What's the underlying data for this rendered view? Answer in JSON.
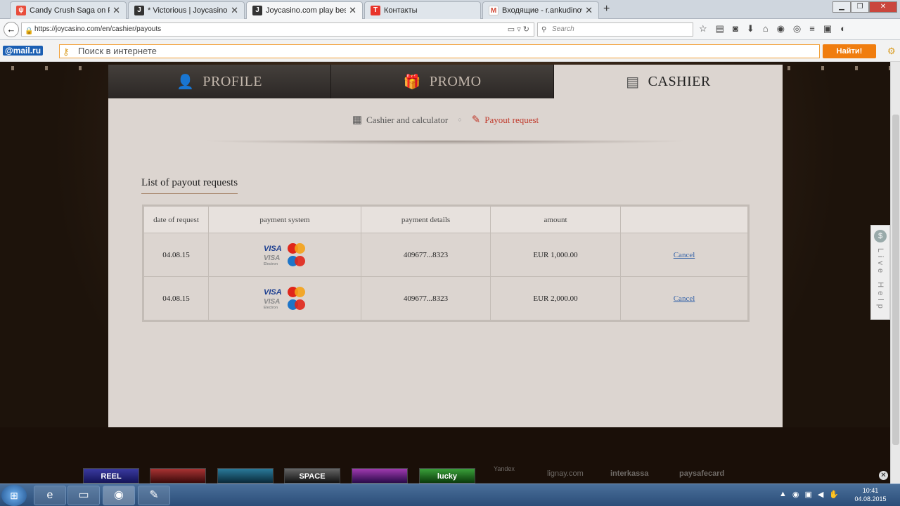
{
  "browser": {
    "tabs": [
      {
        "title": "Candy Crush Saga on Face...",
        "favicon": "candy-icon",
        "color": "#e84d3c",
        "active": false
      },
      {
        "title": "* Victorious | Joycasino.com",
        "favicon": "joycasino-icon",
        "color": "#333333",
        "active": false
      },
      {
        "title": "Joycasino.com play best N...",
        "favicon": "joycasino-icon",
        "color": "#333333",
        "active": true
      },
      {
        "title": "Контакты",
        "favicon": "t-icon",
        "color": "#e8332a",
        "active": false
      },
      {
        "title": "Входящие - r.ankudinovas...",
        "favicon": "gmail-icon",
        "color": "#d14836",
        "active": false
      }
    ],
    "new_tab_label": "+",
    "url": "https://joycasino.com/en/cashier/payouts",
    "search_placeholder": "Search",
    "mailru": {
      "logo": "@mail.ru",
      "search_placeholder": "Поиск в интернете",
      "find_button": "Найти!"
    }
  },
  "site": {
    "tabs": [
      {
        "label": "PROFILE",
        "icon": "user-icon"
      },
      {
        "label": "PROMO",
        "icon": "gift-icon"
      },
      {
        "label": "CASHIER",
        "icon": "wallet-icon"
      }
    ],
    "subnav": {
      "calculator": "Cashier and calculator",
      "payout": "Payout request"
    },
    "list_title": "List of payout requests",
    "table": {
      "headers": [
        "date of request",
        "payment system",
        "payment details",
        "amount",
        ""
      ],
      "rows": [
        {
          "date": "04.08.15",
          "details": "409677...8323",
          "amount": "EUR 1,000.00",
          "action": "Cancel"
        },
        {
          "date": "04.08.15",
          "details": "409677...8323",
          "amount": "EUR 2,000.00",
          "action": "Cancel"
        }
      ],
      "card_labels": {
        "visa": "VISA",
        "visa_electron": "VISA",
        "electron": "Electron"
      }
    },
    "live_help": "Live Help",
    "footer": {
      "games": [
        "REEL",
        "",
        "",
        "SPACE",
        "",
        "lucky"
      ],
      "payments": [
        "Yandex",
        "lignay.com",
        "interkassa",
        "paysafecard"
      ]
    }
  },
  "taskbar": {
    "time": "10:41",
    "date": "04.08.2015"
  }
}
